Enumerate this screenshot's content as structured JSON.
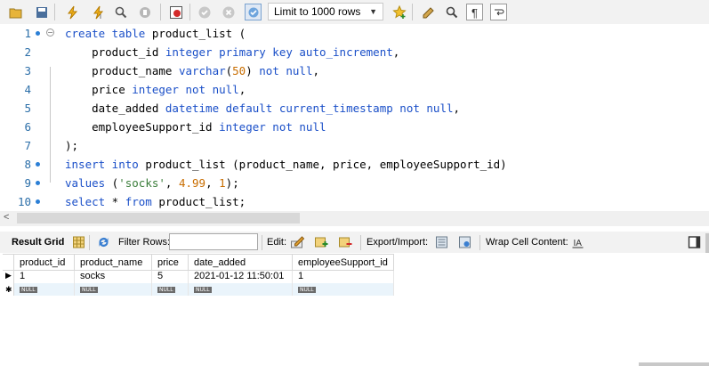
{
  "toolbar": {
    "limit_label": "Limit to 1000 rows",
    "icons": [
      "folder-open-icon",
      "save-icon",
      "execute-icon",
      "execute-current-icon",
      "explain-icon",
      "stop-icon",
      "toggle-error-icon",
      "commit-icon",
      "rollback-icon",
      "autocommit-icon",
      "bookmark-icon",
      "beautify-icon",
      "find-icon",
      "invisible-chars-icon",
      "wrap-icon"
    ]
  },
  "editor": {
    "lines": [
      {
        "n": "1",
        "tokens": [
          [
            "kw",
            "create table"
          ],
          [
            "pl",
            " product_list ("
          ]
        ]
      },
      {
        "n": "2",
        "tokens": [
          [
            "pl",
            "    product_id "
          ],
          [
            "kw",
            "integer primary key auto_increment"
          ],
          [
            "pl",
            ","
          ]
        ]
      },
      {
        "n": "3",
        "tokens": [
          [
            "pl",
            "    product_name "
          ],
          [
            "kw",
            "varchar"
          ],
          [
            "pl",
            "("
          ],
          [
            "num",
            "50"
          ],
          [
            "pl",
            ") "
          ],
          [
            "kw",
            "not null"
          ],
          [
            "pl",
            ","
          ]
        ]
      },
      {
        "n": "4",
        "tokens": [
          [
            "pl",
            "    price "
          ],
          [
            "kw",
            "integer not null"
          ],
          [
            "pl",
            ","
          ]
        ]
      },
      {
        "n": "5",
        "tokens": [
          [
            "pl",
            "    date_added "
          ],
          [
            "kw",
            "datetime default current_timestamp not null"
          ],
          [
            "pl",
            ","
          ]
        ]
      },
      {
        "n": "6",
        "tokens": [
          [
            "pl",
            "    employeeSupport_id "
          ],
          [
            "kw",
            "integer not null"
          ]
        ]
      },
      {
        "n": "7",
        "tokens": [
          [
            "pl",
            ");"
          ]
        ]
      },
      {
        "n": "8",
        "tokens": [
          [
            "kw",
            "insert into"
          ],
          [
            "pl",
            " product_list (product_name, price, employeeSupport_id)"
          ]
        ]
      },
      {
        "n": "9",
        "tokens": [
          [
            "kw",
            "values"
          ],
          [
            "pl",
            " ("
          ],
          [
            "str",
            "'socks'"
          ],
          [
            "pl",
            ", "
          ],
          [
            "num",
            "4.99"
          ],
          [
            "pl",
            ", "
          ],
          [
            "num",
            "1"
          ],
          [
            "pl",
            ");"
          ]
        ]
      },
      {
        "n": "10",
        "tokens": [
          [
            "kw",
            "select"
          ],
          [
            "pl",
            " * "
          ],
          [
            "kw",
            "from"
          ],
          [
            "pl",
            " product_list;"
          ]
        ]
      }
    ],
    "dot_lines": [
      "1",
      "8",
      "9",
      "10"
    ]
  },
  "result_bar": {
    "result_grid": "Result Grid",
    "filter_rows": "Filter Rows:",
    "filter_value": "",
    "edit": "Edit:",
    "export_import": "Export/Import:",
    "wrap": "Wrap Cell Content:"
  },
  "grid": {
    "columns": [
      "product_id",
      "product_name",
      "price",
      "date_added",
      "employeeSupport_id"
    ],
    "rows": [
      [
        "1",
        "socks",
        "5",
        "2021-01-12 11:50:01",
        "1"
      ]
    ],
    "null_label": "NULL"
  }
}
